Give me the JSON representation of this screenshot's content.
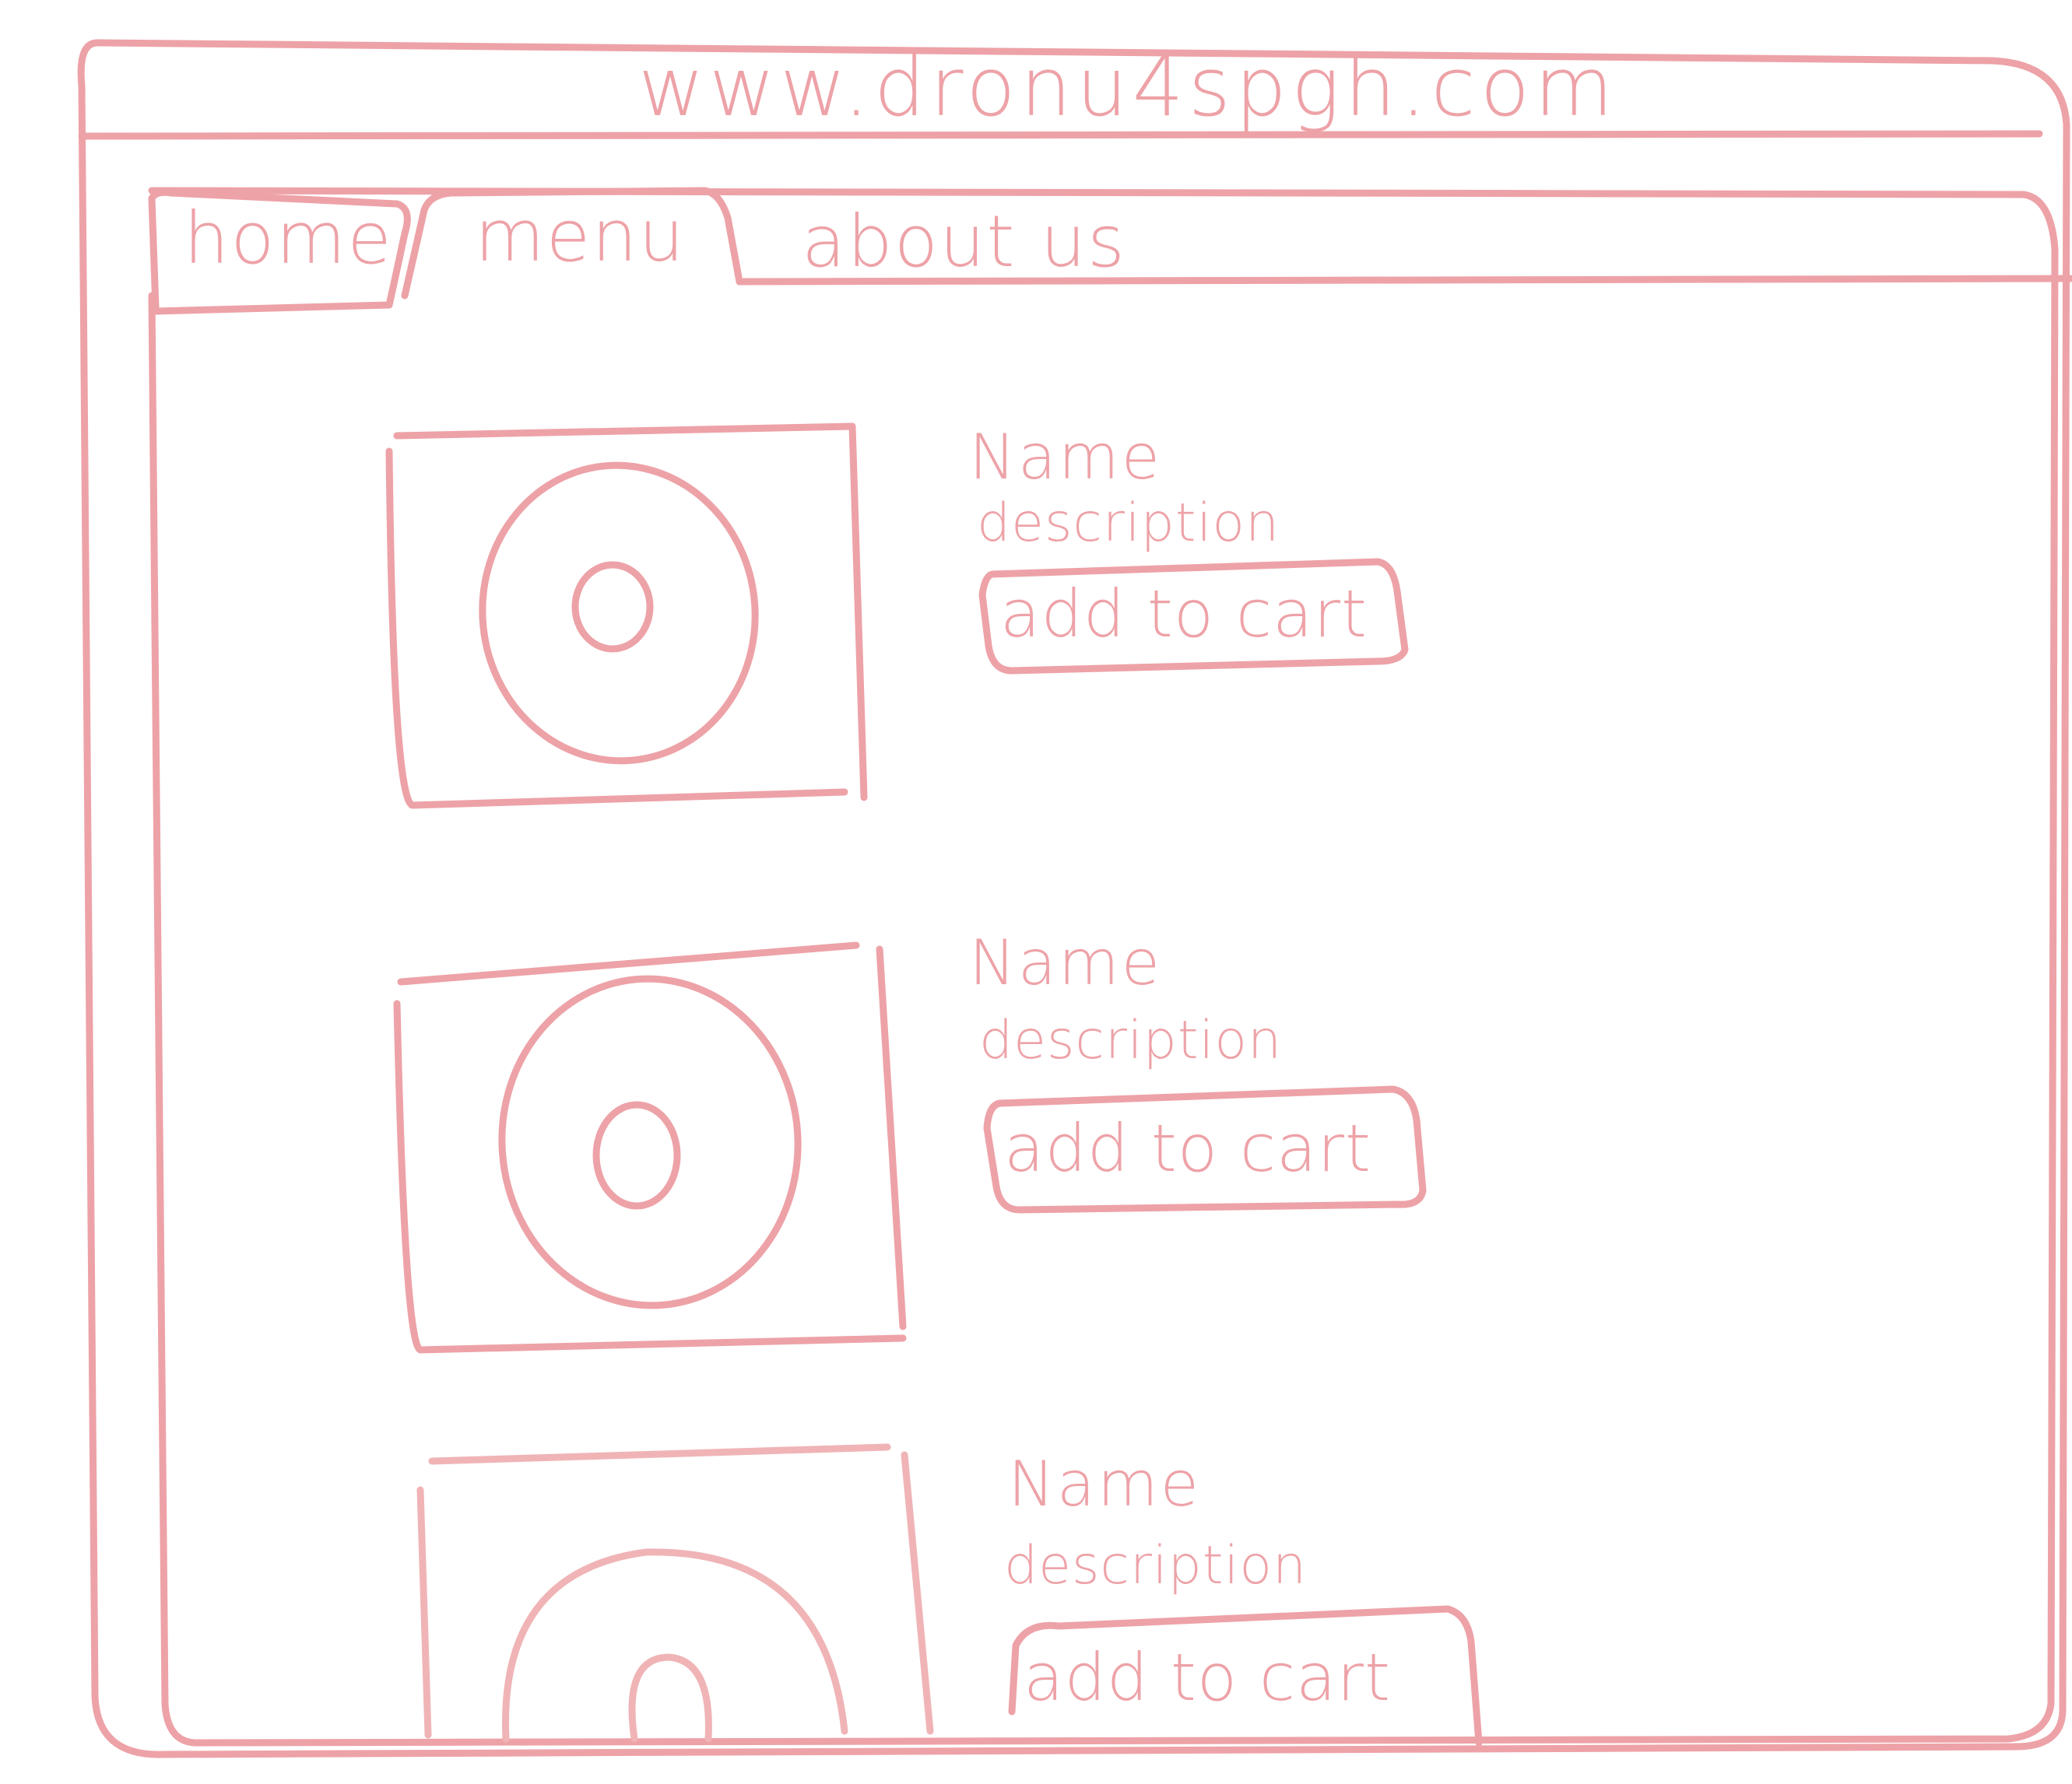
{
  "browser": {
    "url": "www.dronu4spgh.com"
  },
  "tabs": [
    {
      "label": "home"
    },
    {
      "label": "menu",
      "active": true
    },
    {
      "label": "about us"
    }
  ],
  "menu_items": [
    {
      "name": "Name",
      "description": "description",
      "button_label": "add to cart",
      "image_icon": "donut-icon"
    },
    {
      "name": "Name",
      "description": "description",
      "button_label": "add to cart",
      "image_icon": "donut-icon"
    },
    {
      "name": "Name",
      "description": "description",
      "button_label": "add to cart",
      "image_icon": "donut-icon"
    }
  ],
  "colors": {
    "ink": "#eda2a7",
    "background": "#ffffff"
  }
}
